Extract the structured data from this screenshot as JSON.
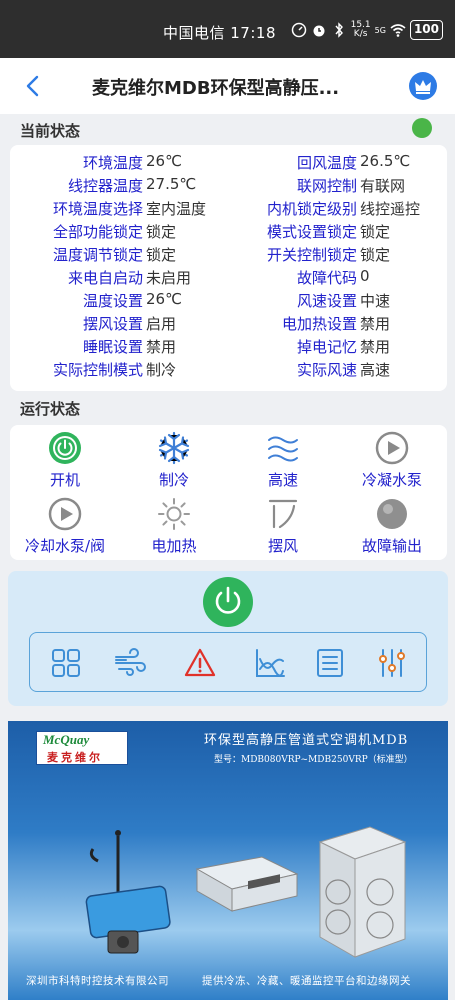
{
  "statusbar": {
    "carrier_time": "中国电信 17:18",
    "net_speed_top": "15.1",
    "net_speed_bottom": "K/s",
    "signal_label": "5G",
    "battery": "100"
  },
  "header": {
    "title": "麦克维尔MDB环保型高静压..."
  },
  "current_status": {
    "label": "当前状态",
    "online_color": "#4ab548",
    "rows": [
      {
        "l1": "环境温度",
        "v1": "26℃",
        "l2": "回风温度",
        "v2": "26.5℃"
      },
      {
        "l1": "线控器温度",
        "v1": "27.5℃",
        "l2": "联网控制",
        "v2": "有联网"
      },
      {
        "l1": "环境温度选择",
        "v1": "室内温度",
        "l2": "内机锁定级别",
        "v2": "线控遥控"
      },
      {
        "l1": "全部功能锁定",
        "v1": "锁定",
        "l2": "模式设置锁定",
        "v2": "锁定"
      },
      {
        "l1": "温度调节锁定",
        "v1": "锁定",
        "l2": "开关控制锁定",
        "v2": "锁定"
      },
      {
        "l1": "来电自启动",
        "v1": "未启用",
        "l2": "故障代码",
        "v2": "0"
      },
      {
        "l1": "温度设置",
        "v1": "26℃",
        "l2": "风速设置",
        "v2": "中速"
      },
      {
        "l1": "摆风设置",
        "v1": "启用",
        "l2": "电加热设置",
        "v2": "禁用"
      },
      {
        "l1": "睡眠设置",
        "v1": "禁用",
        "l2": "掉电记忆",
        "v2": "禁用"
      },
      {
        "l1": "实际控制模式",
        "v1": "制冷",
        "l2": "实际风速",
        "v2": "高速"
      }
    ]
  },
  "run_status": {
    "label": "运行状态",
    "items": [
      {
        "label": "开机",
        "icon": "power-on-icon"
      },
      {
        "label": "制冷",
        "icon": "snowflake-icon"
      },
      {
        "label": "高速",
        "icon": "wind-waves-icon"
      },
      {
        "label": "冷凝水泵",
        "icon": "play-circle-icon"
      },
      {
        "label": "冷却水泵/阀",
        "icon": "play-circle-icon"
      },
      {
        "label": "电加热",
        "icon": "sun-icon"
      },
      {
        "label": "摆风",
        "icon": "swing-icon"
      },
      {
        "label": "故障输出",
        "icon": "gray-dot-icon"
      }
    ]
  },
  "controls": {
    "power_color": "#2fb45c",
    "tools": [
      "grid-icon",
      "wind-icon",
      "warning-icon",
      "chart-icon",
      "list-icon",
      "sliders-icon"
    ]
  },
  "banner": {
    "logo_en": "McQuay",
    "logo_cn": "麦克维尔",
    "title": "环保型高静压管道式空调机MDB",
    "model": "型号：MDB080VRP~MDB250VRP（标准型）",
    "company": "深圳市科特时控技术有限公司",
    "slogan": "提供冷冻、冷藏、暖通监控平台和边缘网关"
  }
}
